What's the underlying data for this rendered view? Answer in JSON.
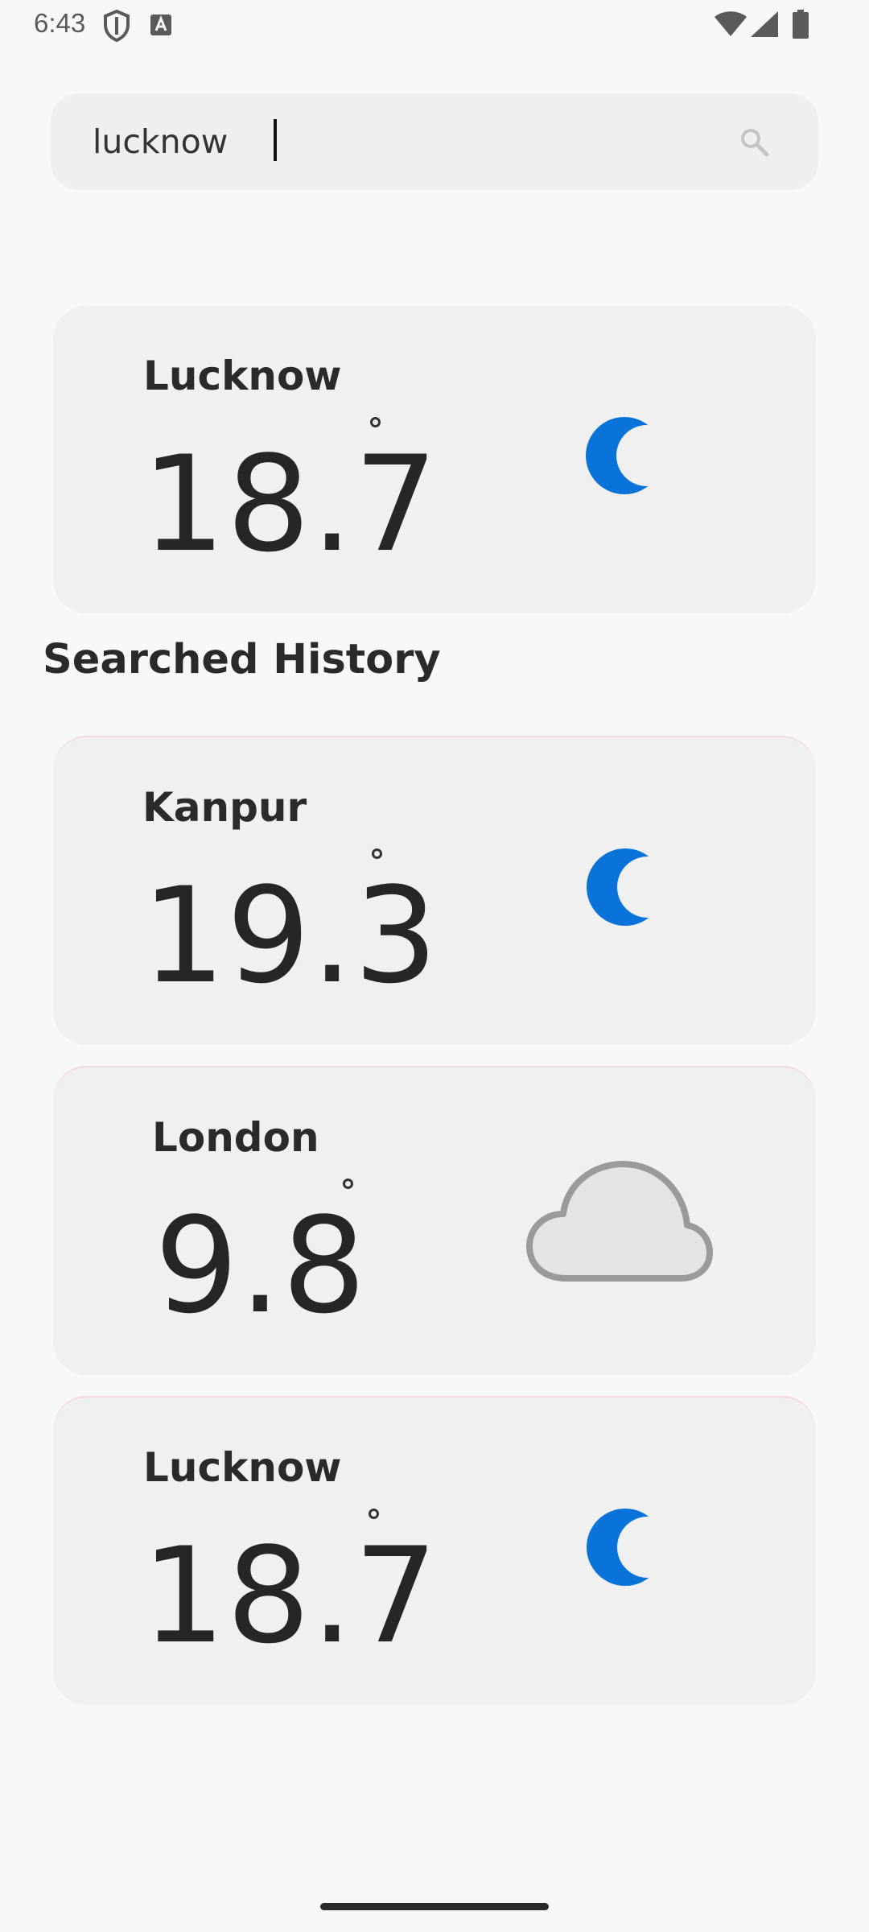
{
  "status_bar": {
    "time": "6:43",
    "icons": [
      "shield-icon",
      "keyboard-a-icon",
      "wifi-icon",
      "signal-icon",
      "battery-icon"
    ]
  },
  "search": {
    "value": "lucknow",
    "icon": "search-icon"
  },
  "current": {
    "city": "Lucknow",
    "temperature": "18.7",
    "icon": "moon-icon"
  },
  "history": {
    "title": "Searched History",
    "items": [
      {
        "city": "Kanpur",
        "temperature": "19.3",
        "icon": "moon-icon"
      },
      {
        "city": "London",
        "temperature": "9.8",
        "icon": "cloud-icon"
      },
      {
        "city": "Lucknow",
        "temperature": "18.7",
        "icon": "moon-icon"
      }
    ]
  },
  "colors": {
    "background": "#f8f8f8",
    "card": "#f0f0f1",
    "moon": "#0a73d9",
    "cloud_fill": "#e4e4e6",
    "cloud_stroke": "#9a9a9a",
    "text": "#2a2a2a"
  }
}
